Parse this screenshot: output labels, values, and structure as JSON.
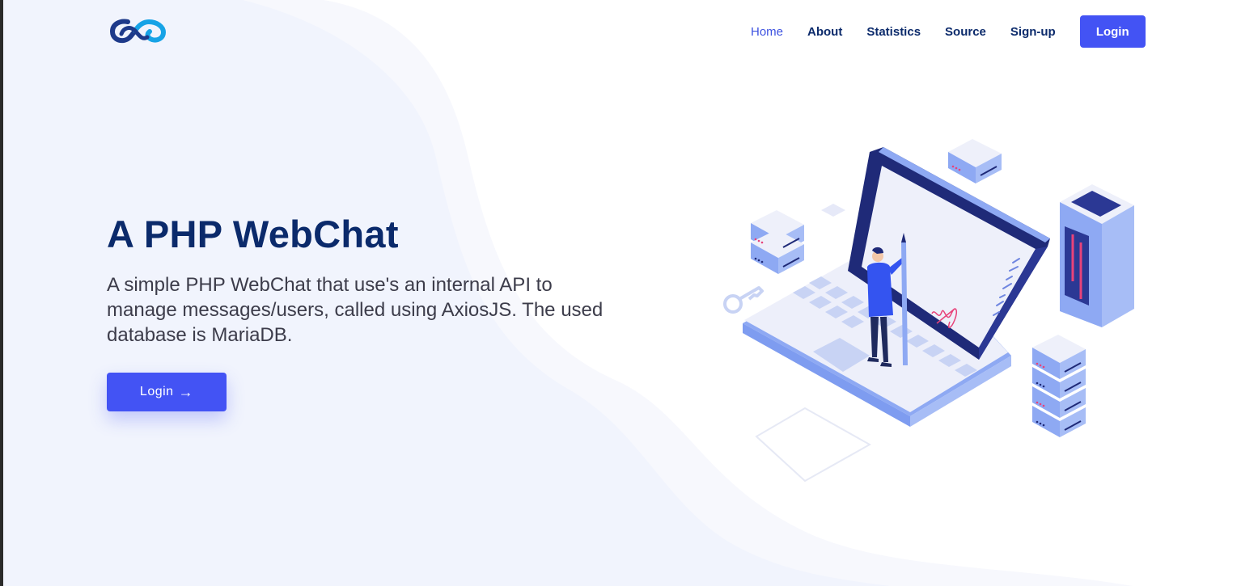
{
  "nav": {
    "items": [
      {
        "label": "Home",
        "active": true
      },
      {
        "label": "About",
        "active": false
      },
      {
        "label": "Statistics",
        "active": false
      },
      {
        "label": "Source",
        "active": false
      },
      {
        "label": "Sign-up",
        "active": false
      }
    ],
    "login_label": "Login"
  },
  "hero": {
    "title": "A PHP WebChat",
    "description": "A simple PHP WebChat that use's an internal API to manage messages/users, called using AxiosJS. The used database is MariaDB.",
    "button_label": "Login",
    "button_icon": "arrow-right-icon"
  },
  "colors": {
    "primary": "#4353f4",
    "heading": "#0b2a6b",
    "nav_active": "#3d52e0",
    "background_tint": "#f1f4fd"
  }
}
